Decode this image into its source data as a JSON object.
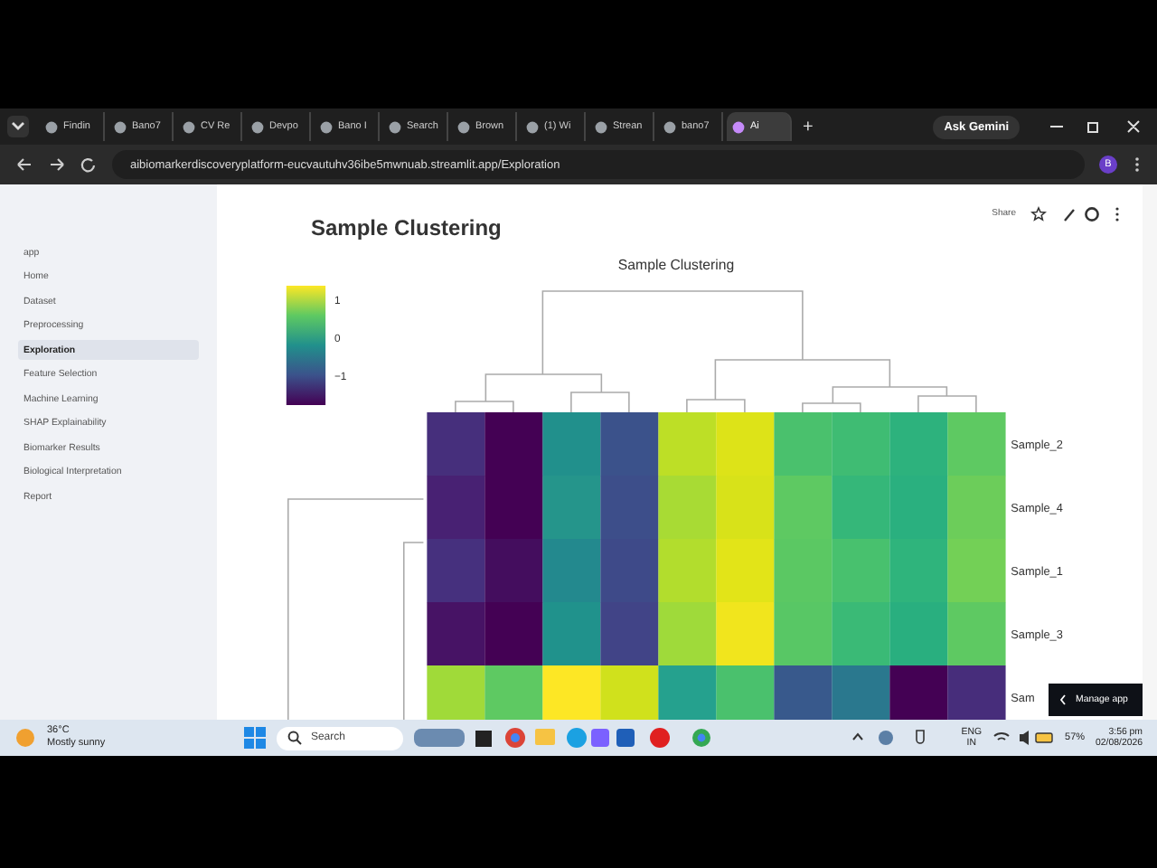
{
  "browser": {
    "tabs": [
      {
        "label": "Findin",
        "selected": false
      },
      {
        "label": "Bano7",
        "selected": false
      },
      {
        "label": "CV Re",
        "selected": false
      },
      {
        "label": "Devpo",
        "selected": false
      },
      {
        "label": "Bano I",
        "selected": false
      },
      {
        "label": "Search",
        "selected": false
      },
      {
        "label": "Brown",
        "selected": false
      },
      {
        "label": "(1) Wi",
        "selected": false
      },
      {
        "label": "Strean",
        "selected": false
      },
      {
        "label": "bano7",
        "selected": false
      },
      {
        "label": "Ai",
        "selected": true
      }
    ],
    "new_tab": "+",
    "ask_gemini": "Ask Gemini",
    "url": "aibiomarkerdiscoveryplatform-eucvautuhv36ibe5mwnuab.streamlit.app/Exploration",
    "profile": "B"
  },
  "sidebar": {
    "items": [
      {
        "label": "app",
        "selected": false
      },
      {
        "label": "Home",
        "selected": false
      },
      {
        "label": "Dataset",
        "selected": false
      },
      {
        "label": "Preprocessing",
        "selected": false
      },
      {
        "label": "Exploration",
        "selected": true
      },
      {
        "label": "Feature Selection",
        "selected": false
      },
      {
        "label": "Machine Learning",
        "selected": false
      },
      {
        "label": "SHAP Explainability",
        "selected": false
      },
      {
        "label": "Biomarker Results",
        "selected": false
      },
      {
        "label": "Biological Interpretation",
        "selected": false
      },
      {
        "label": "Report",
        "selected": false
      }
    ]
  },
  "toolbar": {
    "share": "Share"
  },
  "section": {
    "heading": "Sample Clustering"
  },
  "plot": {
    "title": "Sample Clustering",
    "colorbar_ticks": [
      "1",
      "0",
      "−1"
    ],
    "row_labels": [
      "Sample_2",
      "Sample_4",
      "Sample_1",
      "Sample_3",
      "Sam"
    ]
  },
  "manage_app": "Manage app",
  "taskbar": {
    "temperature": "36°C",
    "weather": "Mostly sunny",
    "search_placeholder": "Search",
    "language": "ENG",
    "region": "IN",
    "battery": "57%",
    "time": "3:56 pm",
    "date": "02/08/2026"
  }
}
